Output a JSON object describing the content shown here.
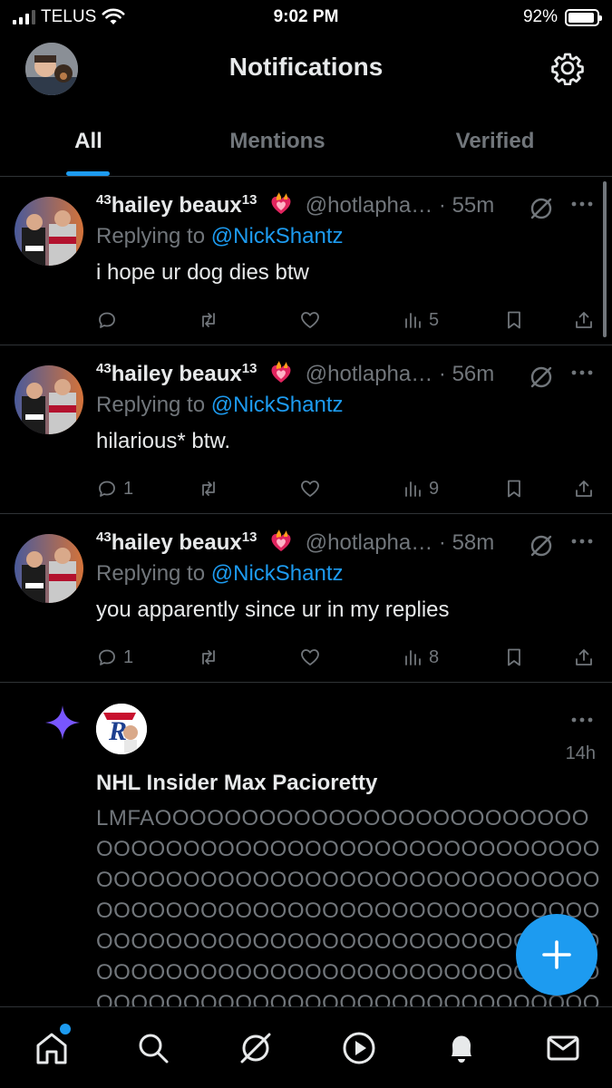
{
  "status_bar": {
    "carrier": "TELUS",
    "time": "9:02 PM",
    "battery": "92%",
    "battery_level": 0.92
  },
  "header": {
    "title": "Notifications"
  },
  "tabs": [
    {
      "label": "All",
      "active": true
    },
    {
      "label": "Mentions",
      "active": false
    },
    {
      "label": "Verified",
      "active": false
    }
  ],
  "tweets": [
    {
      "name_prefix": "43",
      "name": "hailey beaux",
      "name_suffix": "13",
      "handle": "@hotlapha…",
      "time": "· 55m",
      "replying_label": "Replying to",
      "replying_to": "@NickShantz",
      "text": "i hope ur dog dies btw",
      "replies": "",
      "views": "5"
    },
    {
      "name_prefix": "43",
      "name": "hailey beaux",
      "name_suffix": "13",
      "handle": "@hotlapha…",
      "time": "· 56m",
      "replying_label": "Replying to",
      "replying_to": "@NickShantz",
      "text": "hilarious* btw.",
      "replies": "1",
      "views": "9"
    },
    {
      "name_prefix": "43",
      "name": "hailey beaux",
      "name_suffix": "13",
      "handle": "@hotlapha…",
      "time": "· 58m",
      "replying_label": "Replying to",
      "replying_to": "@NickShantz",
      "text": "you apparently since ur in my replies",
      "replies": "1",
      "views": "8"
    }
  ],
  "post5": {
    "time": "14h",
    "name": "NHL Insider Max Pacioretty",
    "body": "LMFAOOOOOOOOOOOOOOOOOOOOOOOOOOOOOOOOOOOOOOOOOOOOOOOOOOOOOOOOOOOOOOOOOOOOOOOOOOOOOOOOOOOOOOOOOOOOOOOOOOOOOOOOOOOOOOOOOOOOOOOOOOOOOOOOOOOOOOOOOOOOOOOOOOOOOOOOOOOOOOOOOOOOOOOOOOOOOOOOOOOOOOOOOOOOOOOOOOOOOOOOOOOOOOOOOOOOOOOOOOOOOOOOOO"
  },
  "colors": {
    "accent": "#1d9bf0",
    "muted": "#71767b",
    "text": "#e7e9ea",
    "grok": "#7856ff"
  }
}
